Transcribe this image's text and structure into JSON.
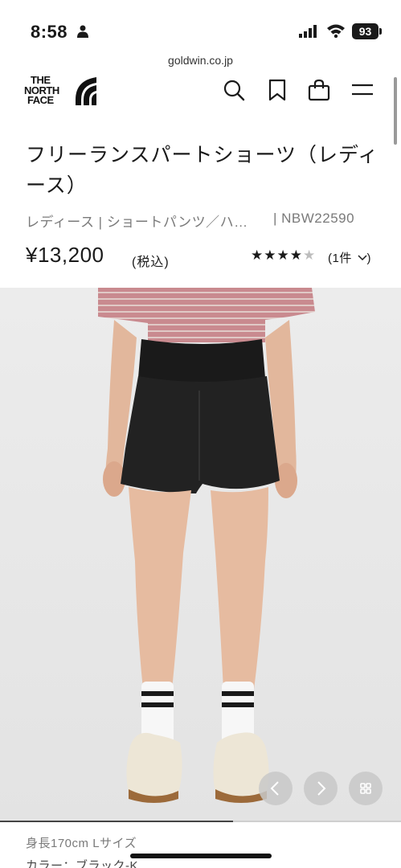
{
  "status_bar": {
    "time": "8:58",
    "battery": "93",
    "icons": [
      "person-icon",
      "signal-icon",
      "wifi-icon",
      "battery-icon"
    ]
  },
  "browser": {
    "url": "goldwin.co.jp"
  },
  "header": {
    "logo_lines": [
      "THE",
      "NORTH",
      "FACE"
    ],
    "icons": [
      "search-icon",
      "bookmark-icon",
      "bag-icon",
      "menu-icon"
    ]
  },
  "product": {
    "title": "フリーランスパートショーツ（レディース）",
    "category": "レディース | ショートパンツ／ハ…",
    "model_number": "| NBW22590",
    "price": "¥13,200",
    "tax_label": "(税込)",
    "rating": 4,
    "rating_max": 5,
    "reviews": "(1件",
    "reviews_chevron": "chevron-down-icon"
  },
  "photo": {
    "icons": [
      "chevron-left-icon",
      "chevron-right-icon",
      "grid-icon"
    ],
    "colors": {
      "background": "#e9e9e9",
      "shirt": "#c98a8f",
      "shorts": "#1e1e1e",
      "sneakers": "#ede6d6"
    }
  },
  "details": {
    "model_size": "身長170cm Lサイズ",
    "color_line": "カラー：ブラック-K"
  }
}
